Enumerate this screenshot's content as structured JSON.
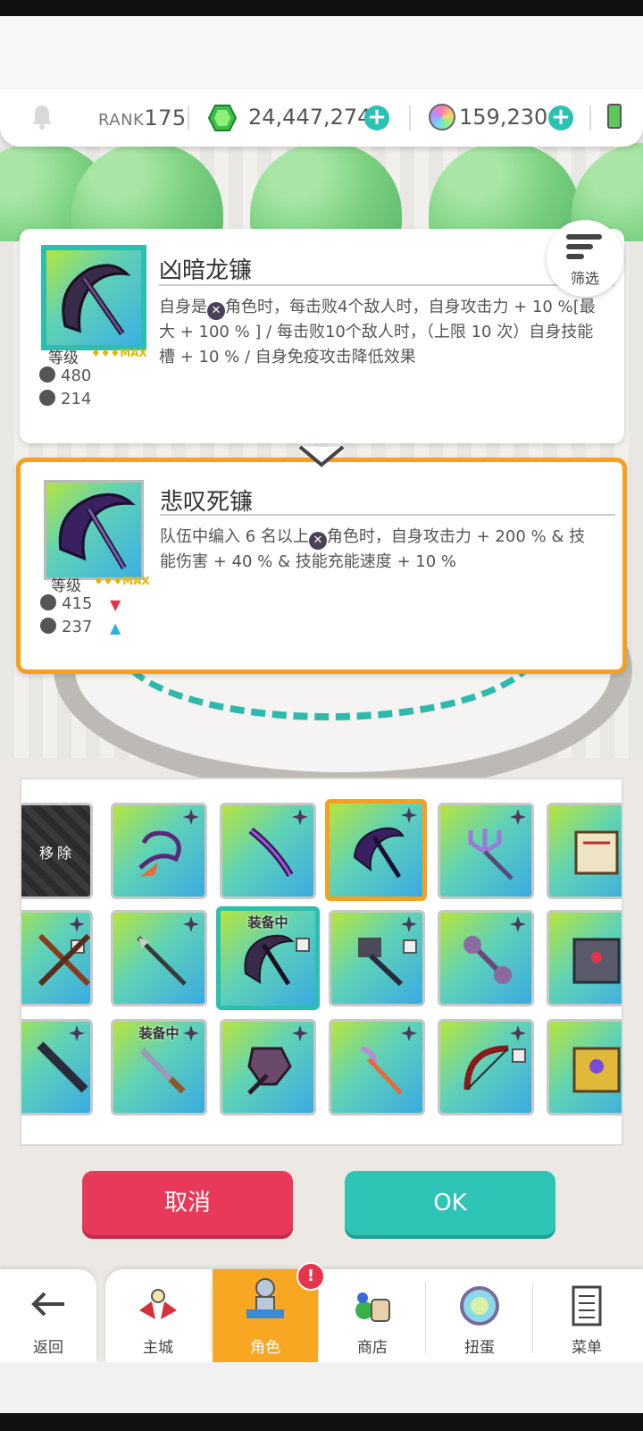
{
  "header": {
    "rank_label": "RANK",
    "rank_value": "175",
    "gems": "24,447,274",
    "orbs": "159,230",
    "icons": [
      "bell-icon",
      "gem-icon",
      "orb-icon",
      "battery-icon"
    ]
  },
  "sort_button": {
    "label": "筛选"
  },
  "current_item": {
    "name": "凶暗龙镰",
    "level_label": "等级",
    "level_badge": "MAX",
    "hp": "480",
    "atk": "214",
    "desc_pre": "自身是",
    "desc_post": "角色时，每击败4个敌人时，自身攻击力 + 10 %[最大 + 100 % ] / 每击败10个敌人时，（上限 10 次）自身技能槽 + 10 % / 自身免疫攻击降低效果"
  },
  "compare_item": {
    "name": "悲叹死镰",
    "level_label": "等级",
    "level_badge": "MAX",
    "hp": "415",
    "atk": "237",
    "desc_pre": "队伍中编入 6 名以上",
    "desc_post": "角色时，自身攻击力 + 200 % & 技能伤害 + 40 % & 技能充能速度 + 10 %"
  },
  "grid": {
    "remove_label": "移除",
    "equipped_label": "装备中"
  },
  "buttons": {
    "cancel": "取消",
    "ok": "OK"
  },
  "nav": {
    "back": "返回",
    "tabs": [
      "主城",
      "角色",
      "商店",
      "扭蛋",
      "菜单"
    ],
    "alert": "!"
  },
  "colors": {
    "accent_teal": "#2ec4b6",
    "accent_orange": "#f5a020",
    "cancel_red": "#e8395a"
  }
}
